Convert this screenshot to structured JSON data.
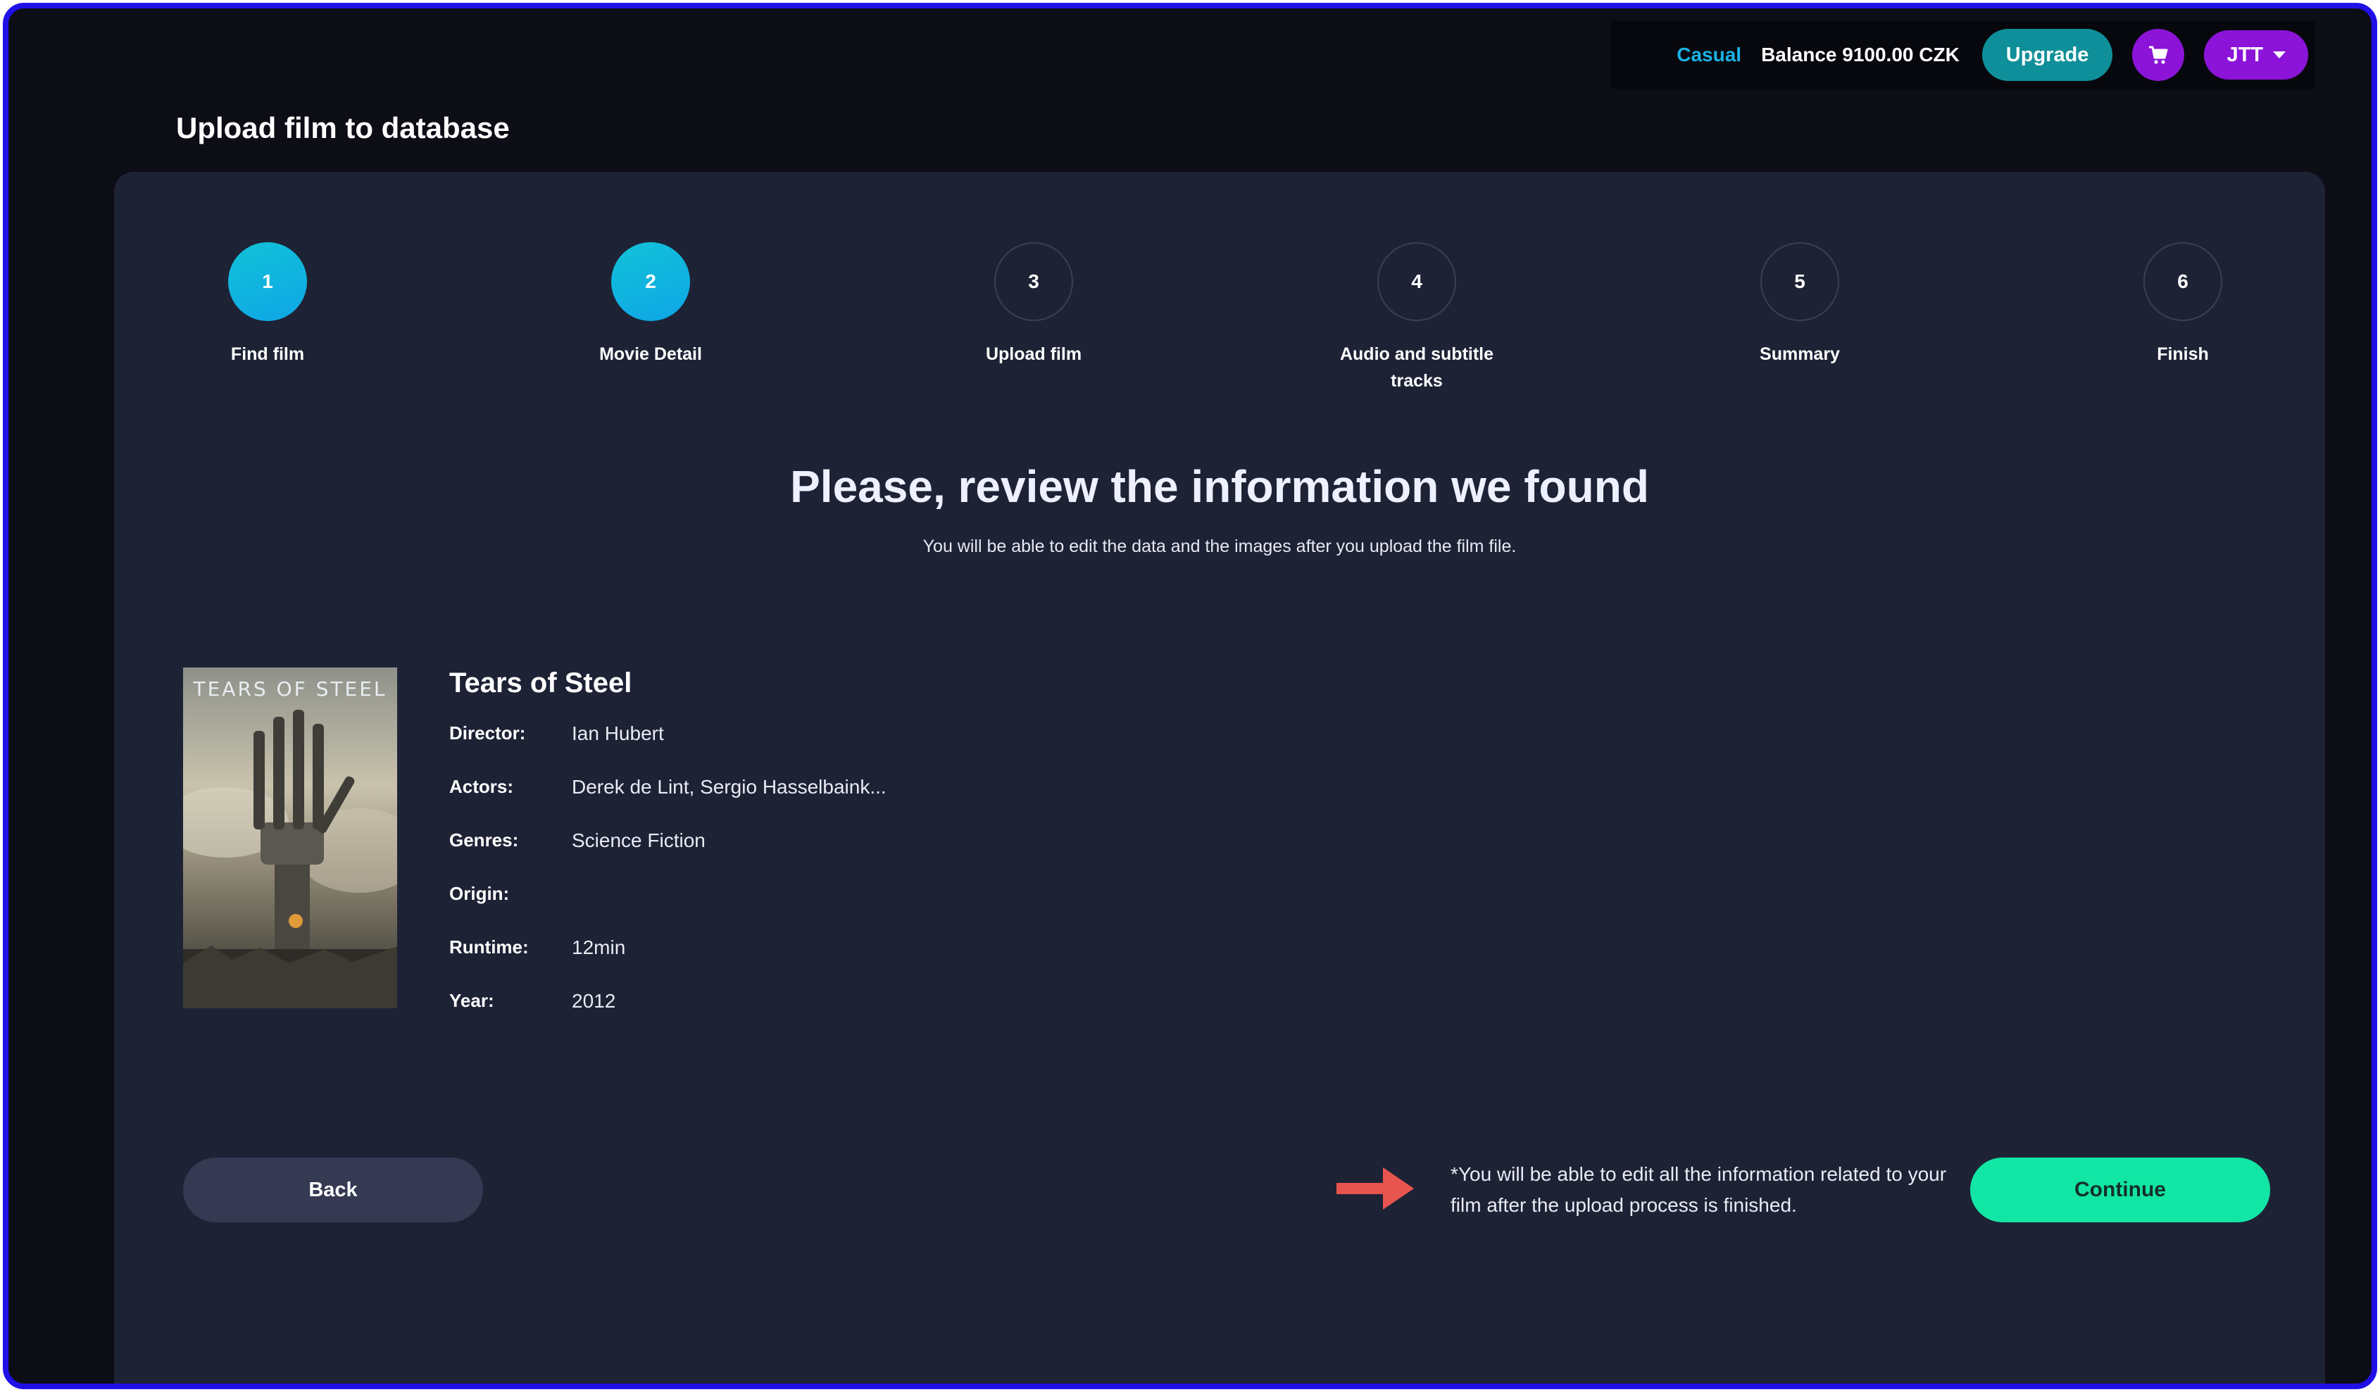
{
  "header": {
    "plan": "Casual",
    "balance": "Balance 9100.00 CZK",
    "upgrade_label": "Upgrade",
    "cart_icon": "cart-icon",
    "user_label": "JTT"
  },
  "page": {
    "title": "Upload film to database"
  },
  "stepper": {
    "steps": [
      {
        "number": "1",
        "label": "Find film",
        "state": "done"
      },
      {
        "number": "2",
        "label": "Movie Detail",
        "state": "done"
      },
      {
        "number": "3",
        "label": "Upload film",
        "state": "pending"
      },
      {
        "number": "4",
        "label": "Audio and subtitle tracks",
        "state": "pending"
      },
      {
        "number": "5",
        "label": "Summary",
        "state": "pending"
      },
      {
        "number": "6",
        "label": "Finish",
        "state": "pending"
      }
    ]
  },
  "review": {
    "heading": "Please, review the information we found",
    "subheading": "You will be able to edit the data and the images after you upload the film file."
  },
  "film": {
    "title": "Tears of Steel",
    "poster_text": "TEARS OF STEEL",
    "details": [
      {
        "key": "Director:",
        "value": "Ian Hubert"
      },
      {
        "key": "Actors:",
        "value": "Derek de Lint, Sergio Hasselbaink..."
      },
      {
        "key": "Genres:",
        "value": "Science Fiction"
      },
      {
        "key": "Origin:",
        "value": ""
      },
      {
        "key": "Runtime:",
        "value": "12min"
      },
      {
        "key": "Year:",
        "value": "2012"
      }
    ]
  },
  "actions": {
    "back_label": "Back",
    "note": "*You will be able to edit all the information related to your film after the upload process is finished.",
    "continue_label": "Continue"
  },
  "colors": {
    "accent_teal": "#12c2d8",
    "continue_green": "#12e6a4",
    "purple": "#8b14d8",
    "plan_blue": "#1ab3e6",
    "arrow_red": "#e8544e"
  }
}
